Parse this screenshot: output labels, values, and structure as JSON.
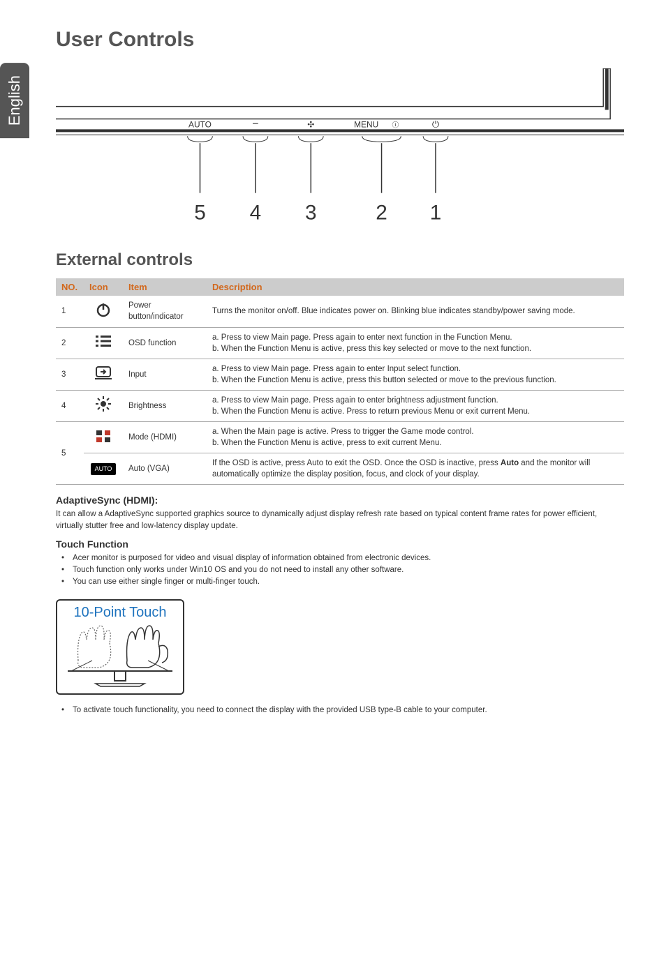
{
  "lang_tab": "English",
  "title_main": "User Controls",
  "title_external": "External controls",
  "monitor_buttons": [
    "AUTO",
    "−",
    "✣",
    "MENU",
    "ⓘ",
    "⏻"
  ],
  "monitor_numbers": [
    "5",
    "4",
    "3",
    "2",
    "1"
  ],
  "table": {
    "headers": {
      "no": "NO.",
      "icon": "Icon",
      "item": "Item",
      "desc": "Description"
    },
    "rows": [
      {
        "no": "1",
        "icon_name": "power-icon",
        "item": "Power button/indicator",
        "desc": "Turns the monitor on/off. Blue indicates power on. Blinking blue indicates standby/power saving mode."
      },
      {
        "no": "2",
        "icon_name": "menu-list-icon",
        "item": "OSD function",
        "desc": "a. Press to view Main page. Press again to enter next function in the Function Menu.\nb. When the Function Menu is active, press this key selected or move to the next function."
      },
      {
        "no": "3",
        "icon_name": "input-icon",
        "item": "Input",
        "desc": "a. Press to view Main page. Press again to enter Input select function.\nb. When the Function Menu is active, press this button selected or move to the previous function."
      },
      {
        "no": "4",
        "icon_name": "brightness-icon",
        "item": "Brightness",
        "desc": "a. Press to view Main page. Press again to enter brightness adjustment function.\nb. When the Function Menu is active. Press to return previous Menu or exit current Menu."
      },
      {
        "no": "5",
        "icon_name": "mode-icon",
        "item_a": "Mode (HDMI)",
        "desc_a": "a. When the Main page is active. Press to trigger the Game mode control.\nb. When the Function Menu is active, press to exit current Menu.",
        "icon_name_b": "auto-badge-icon",
        "icon_text_b": "AUTO",
        "item_b": "Auto (VGA)",
        "desc_b_prefix": "If the OSD is active, press Auto to exit the OSD. Once the OSD is inactive, press ",
        "desc_b_bold": "Auto",
        "desc_b_suffix": " and the monitor will automatically optimize the display position, focus, and clock of your display."
      }
    ]
  },
  "adaptive": {
    "heading": "AdaptiveSync (HDMI):",
    "text": "It can allow a AdaptiveSync supported graphics source to dynamically adjust display refresh rate based on typical content frame rates for power efficient, virtually stutter free and low-latency display update."
  },
  "touch": {
    "heading": "Touch Function",
    "bullets_top": [
      "Acer monitor is purposed for video and visual display of information obtained from electronic devices.",
      "Touch function only works under Win10 OS and you do not need to install any other software.",
      "You can use either single finger or multi-finger touch."
    ],
    "box_title": "10-Point Touch",
    "bullets_bottom": [
      "To activate touch functionality, you need to connect the display with the provided USB type-B cable to your computer."
    ]
  }
}
